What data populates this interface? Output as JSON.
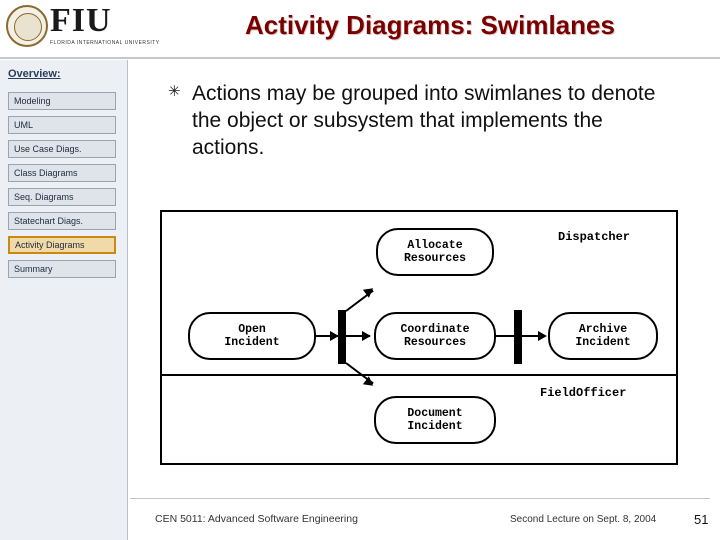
{
  "header": {
    "logo_text": "FIU",
    "logo_subtitle": "FLORIDA INTERNATIONAL UNIVERSITY",
    "title": "Activity Diagrams: Swimlanes"
  },
  "sidebar": {
    "overview_label": "Overview:",
    "items": [
      {
        "label": "Modeling",
        "active": false
      },
      {
        "label": "UML",
        "active": false
      },
      {
        "label": "Use Case Diags.",
        "active": false
      },
      {
        "label": "Class Diagrams",
        "active": false
      },
      {
        "label": "Seq. Diagrams",
        "active": false
      },
      {
        "label": "Statechart Diags.",
        "active": false
      },
      {
        "label": "Activity Diagrams",
        "active": true
      },
      {
        "label": "Summary",
        "active": false
      }
    ]
  },
  "content": {
    "bullet_marker": "✳",
    "bullet_text": "Actions may be grouped into swimlanes to denote the object or subsystem that implements the actions."
  },
  "diagram": {
    "lanes": [
      {
        "name": "Dispatcher"
      },
      {
        "name": "FieldOfficer"
      }
    ],
    "activities": [
      {
        "id": "open-incident",
        "lines": [
          "Open",
          "Incident"
        ]
      },
      {
        "id": "allocate-resources",
        "lines": [
          "Allocate",
          "Resources"
        ]
      },
      {
        "id": "coordinate-resources",
        "lines": [
          "Coordinate",
          "Resources"
        ]
      },
      {
        "id": "document-incident",
        "lines": [
          "Document",
          "Incident"
        ]
      },
      {
        "id": "archive-incident",
        "lines": [
          "Archive",
          "Incident"
        ]
      }
    ]
  },
  "footer": {
    "left": "CEN 5011: Advanced Software Engineering",
    "center": "Second Lecture on Sept. 8, 2004",
    "page": "51"
  },
  "colors": {
    "title": "#7a0000",
    "sidebar_bg": "#eceff3",
    "active_nav_bg": "#f2d9a8",
    "active_nav_border": "#c98a14"
  }
}
